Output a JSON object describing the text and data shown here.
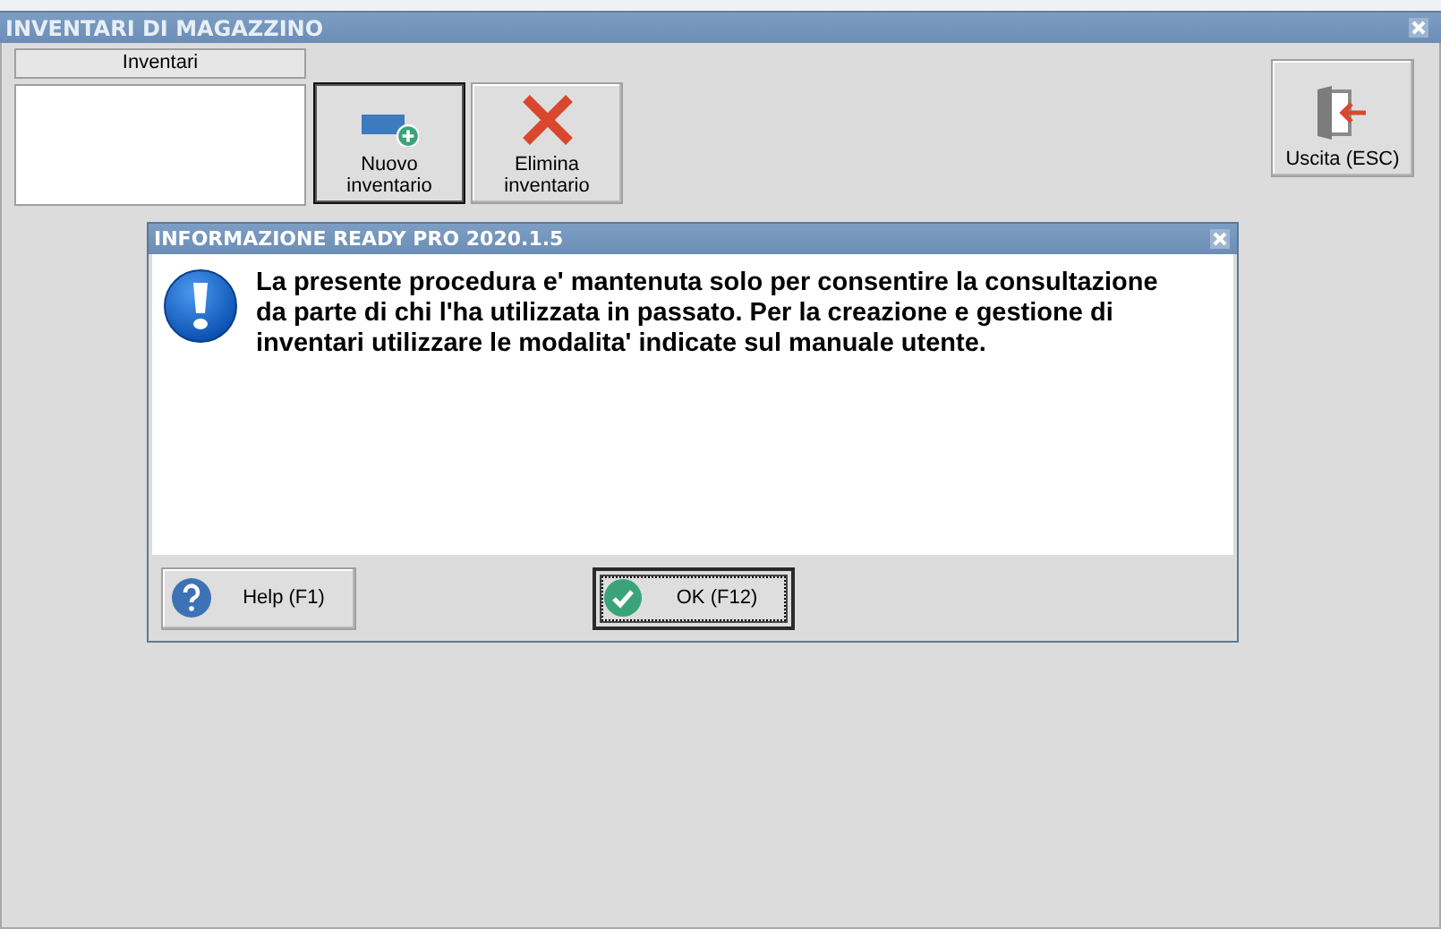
{
  "window": {
    "title": "INVENTARI DI MAGAZZINO"
  },
  "inventory_list": {
    "header": "Inventari"
  },
  "toolbar": [
    {
      "label": "Nuovo inventario",
      "kind": "new"
    },
    {
      "label": "Elimina inventario",
      "kind": "delete"
    }
  ],
  "exit_button": {
    "label": "Uscita (ESC)"
  },
  "dialog": {
    "title": "INFORMAZIONE READY PRO 2020.1.5",
    "message": "La presente procedura e' mantenuta solo per consentire la consultazione da parte di chi l'ha utilizzata in passato. Per la creazione e gestione di inventari utilizzare le modalita' indicate sul manuale utente.",
    "buttons": [
      {
        "label": "Help (F1)",
        "kind": "help",
        "default": false
      },
      {
        "label": "OK (F12)",
        "kind": "ok",
        "default": true
      }
    ]
  }
}
